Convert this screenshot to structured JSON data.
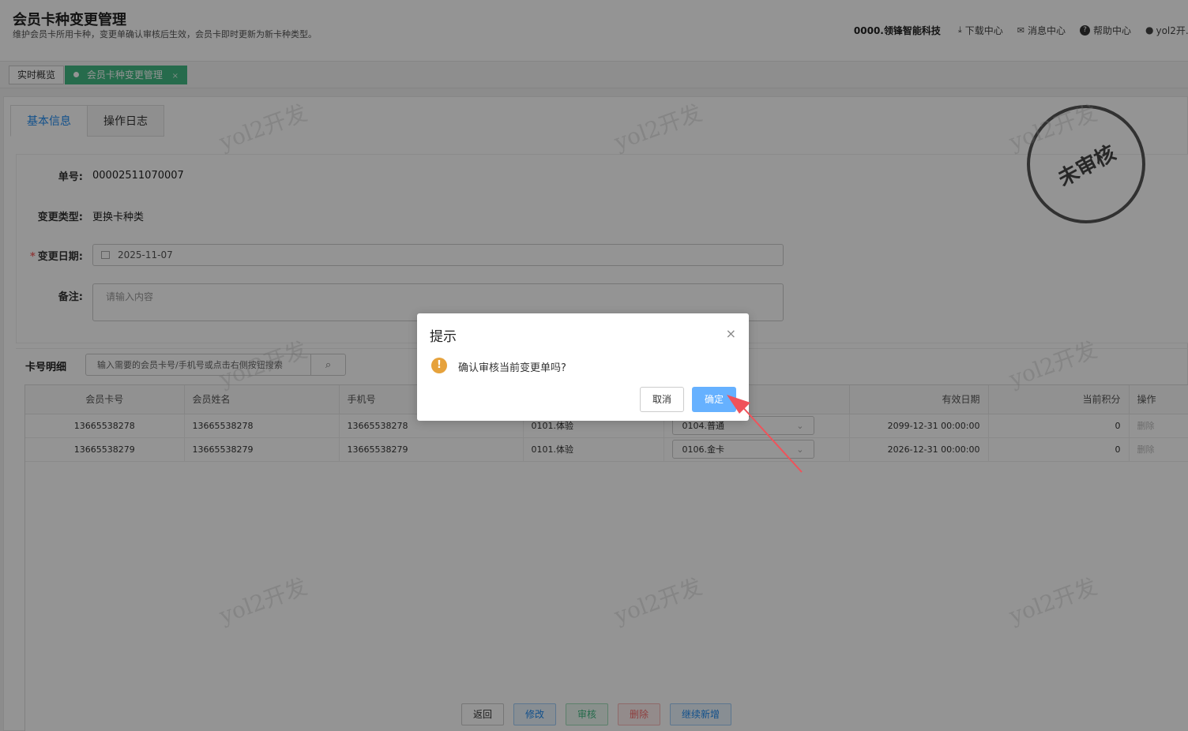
{
  "header": {
    "title": "会员卡种变更管理",
    "subtitle": "维护会员卡所用卡种，变更单确认审核后生效，会员卡即时更新为新卡种类型。",
    "company": "0000.领锋智能科技",
    "download": "下载中心",
    "messages": "消息中心",
    "help": "帮助中心",
    "user": "yol2开..."
  },
  "tabs": [
    {
      "label": "实时概览"
    },
    {
      "label": "会员卡种变更管理",
      "close": "×"
    }
  ],
  "subtabs": [
    "基本信息",
    "操作日志"
  ],
  "form": {
    "order_label": "单号:",
    "order_value": "00002511070007",
    "type_label": "变更类型:",
    "type_value": "更换卡种类",
    "date_label": "变更日期:",
    "date_required": "*",
    "date_value": "2025-11-07",
    "remark_label": "备注:",
    "remark_placeholder": "请输入内容"
  },
  "detail": {
    "title": "卡号明细",
    "search_placeholder": "输入需要的会员卡号/手机号或点击右侧按钮搜索"
  },
  "table": {
    "columns": [
      "会员卡号",
      "会员姓名",
      "手机号",
      "",
      "",
      "有效日期",
      "当前积分",
      "操作"
    ],
    "rows": [
      {
        "card": "13665538278",
        "name": "13665538278",
        "phone": "13665538278",
        "old_type": "0101.体验",
        "new_type": "0104.普通",
        "expire": "2099-12-31 00:00:00",
        "points": "0",
        "op": "删除"
      },
      {
        "card": "13665538279",
        "name": "13665538279",
        "phone": "13665538279",
        "old_type": "0101.体验",
        "new_type": "0106.金卡",
        "expire": "2026-12-31 00:00:00",
        "points": "0",
        "op": "删除"
      }
    ]
  },
  "stamp": "未审核",
  "watermark": "yol2开发",
  "bottom_buttons": {
    "back": "返回",
    "edit": "修改",
    "audit": "审核",
    "delete": "删除",
    "add_more": "继续新增"
  },
  "dialog": {
    "title": "提示",
    "message": "确认审核当前变更单吗?",
    "cancel": "取消",
    "confirm": "确定",
    "close": "×"
  },
  "colors": {
    "accent_green": "#42b983",
    "primary_blue": "#1f8bf0",
    "confirm_blue": "#66b1ff",
    "warning": "#e6a23c",
    "arrow": "#f0525a"
  }
}
